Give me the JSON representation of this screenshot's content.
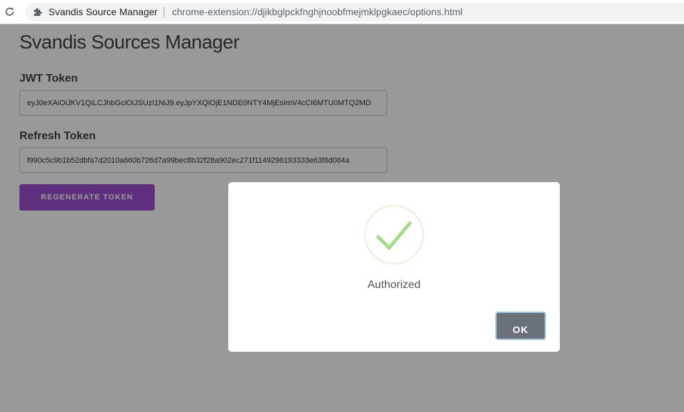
{
  "browser": {
    "site_name": "Svandis Source Manager",
    "url": "chrome-extension://djikbglpckfnghjnoobfmejmklpgkaec/options.html",
    "icons": {
      "reload": "reload-icon",
      "extension": "puzzle-piece-icon"
    }
  },
  "page": {
    "title": "Svandis Sources Manager",
    "jwt": {
      "label": "JWT Token",
      "value": "eyJ0eXAiOiJKV1QiLCJhbGciOiJSUzI1NiJ9.eyJpYXQiOjE1NDE0NTY4MjEsImV4cCI6MTU0MTQ2MD"
    },
    "refresh": {
      "label": "Refresh Token",
      "value": "f990c5c9b1b52dbfa7d2010a660b726d7a99bec8b32f28a902ec271f1149298193333e63f8d084a"
    },
    "regenerate_label": "REGENERATE TOKEN"
  },
  "modal": {
    "icon": "success-checkmark-icon",
    "message": "Authorized",
    "ok_label": "OK"
  },
  "colors": {
    "accent": "#9c4fd0",
    "success": "#a5dc86",
    "ok_button": "#6a7179"
  }
}
